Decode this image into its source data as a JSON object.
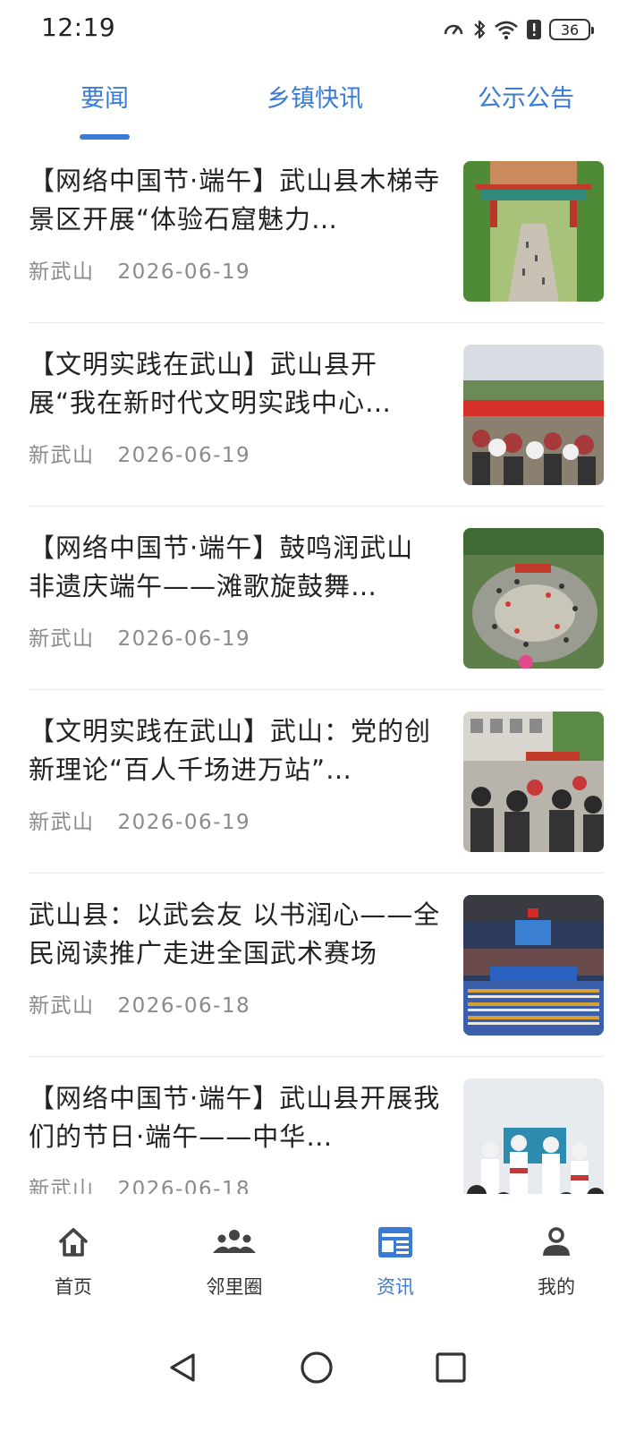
{
  "status": {
    "time": "12:19",
    "battery": "36"
  },
  "tabs": [
    {
      "label": "要闻",
      "active": true
    },
    {
      "label": "乡镇快讯",
      "active": false
    },
    {
      "label": "公示公告",
      "active": false
    }
  ],
  "news": [
    {
      "title": "【网络中国节·端午】武山县木梯寺景区开展“体验石窟魅力…",
      "source": "新武山",
      "date": "2026-06-19",
      "thumb": "temple-gate-photo"
    },
    {
      "title": "【文明实践在武山】武山县开展“我在新时代文明实践中心…",
      "source": "新武山",
      "date": "2026-06-19",
      "thumb": "crowd-outdoor-event-photo"
    },
    {
      "title": "【网络中国节·端午】鼓鸣润武山 非遗庆端午——滩歌旋鼓舞…",
      "source": "新武山",
      "date": "2026-06-19",
      "thumb": "drum-dance-square-photo"
    },
    {
      "title": "【文明实践在武山】武山：党的创新理论“百人千场进万站”…",
      "source": "新武山",
      "date": "2026-06-19",
      "thumb": "village-lecture-photo"
    },
    {
      "title": "武山县：以武会友 以书润心——全民阅读推广走进全国武术赛场",
      "source": "新武山",
      "date": "2026-06-18",
      "thumb": "stadium-ceremony-photo"
    },
    {
      "title": "【网络中国节·端午】武山县开展我们的节日·端午——中华…",
      "source": "新武山",
      "date": "2026-06-18",
      "thumb": "classroom-children-photo"
    }
  ],
  "bottom_nav": [
    {
      "label": "首页",
      "icon": "home-icon",
      "active": false
    },
    {
      "label": "邻里圈",
      "icon": "community-icon",
      "active": false
    },
    {
      "label": "资讯",
      "icon": "news-icon",
      "active": true
    },
    {
      "label": "我的",
      "icon": "profile-icon",
      "active": false
    }
  ],
  "colors": {
    "accent": "#3a7bd5",
    "text": "#222222",
    "meta": "#8a8a8a",
    "divider": "#ececec"
  }
}
